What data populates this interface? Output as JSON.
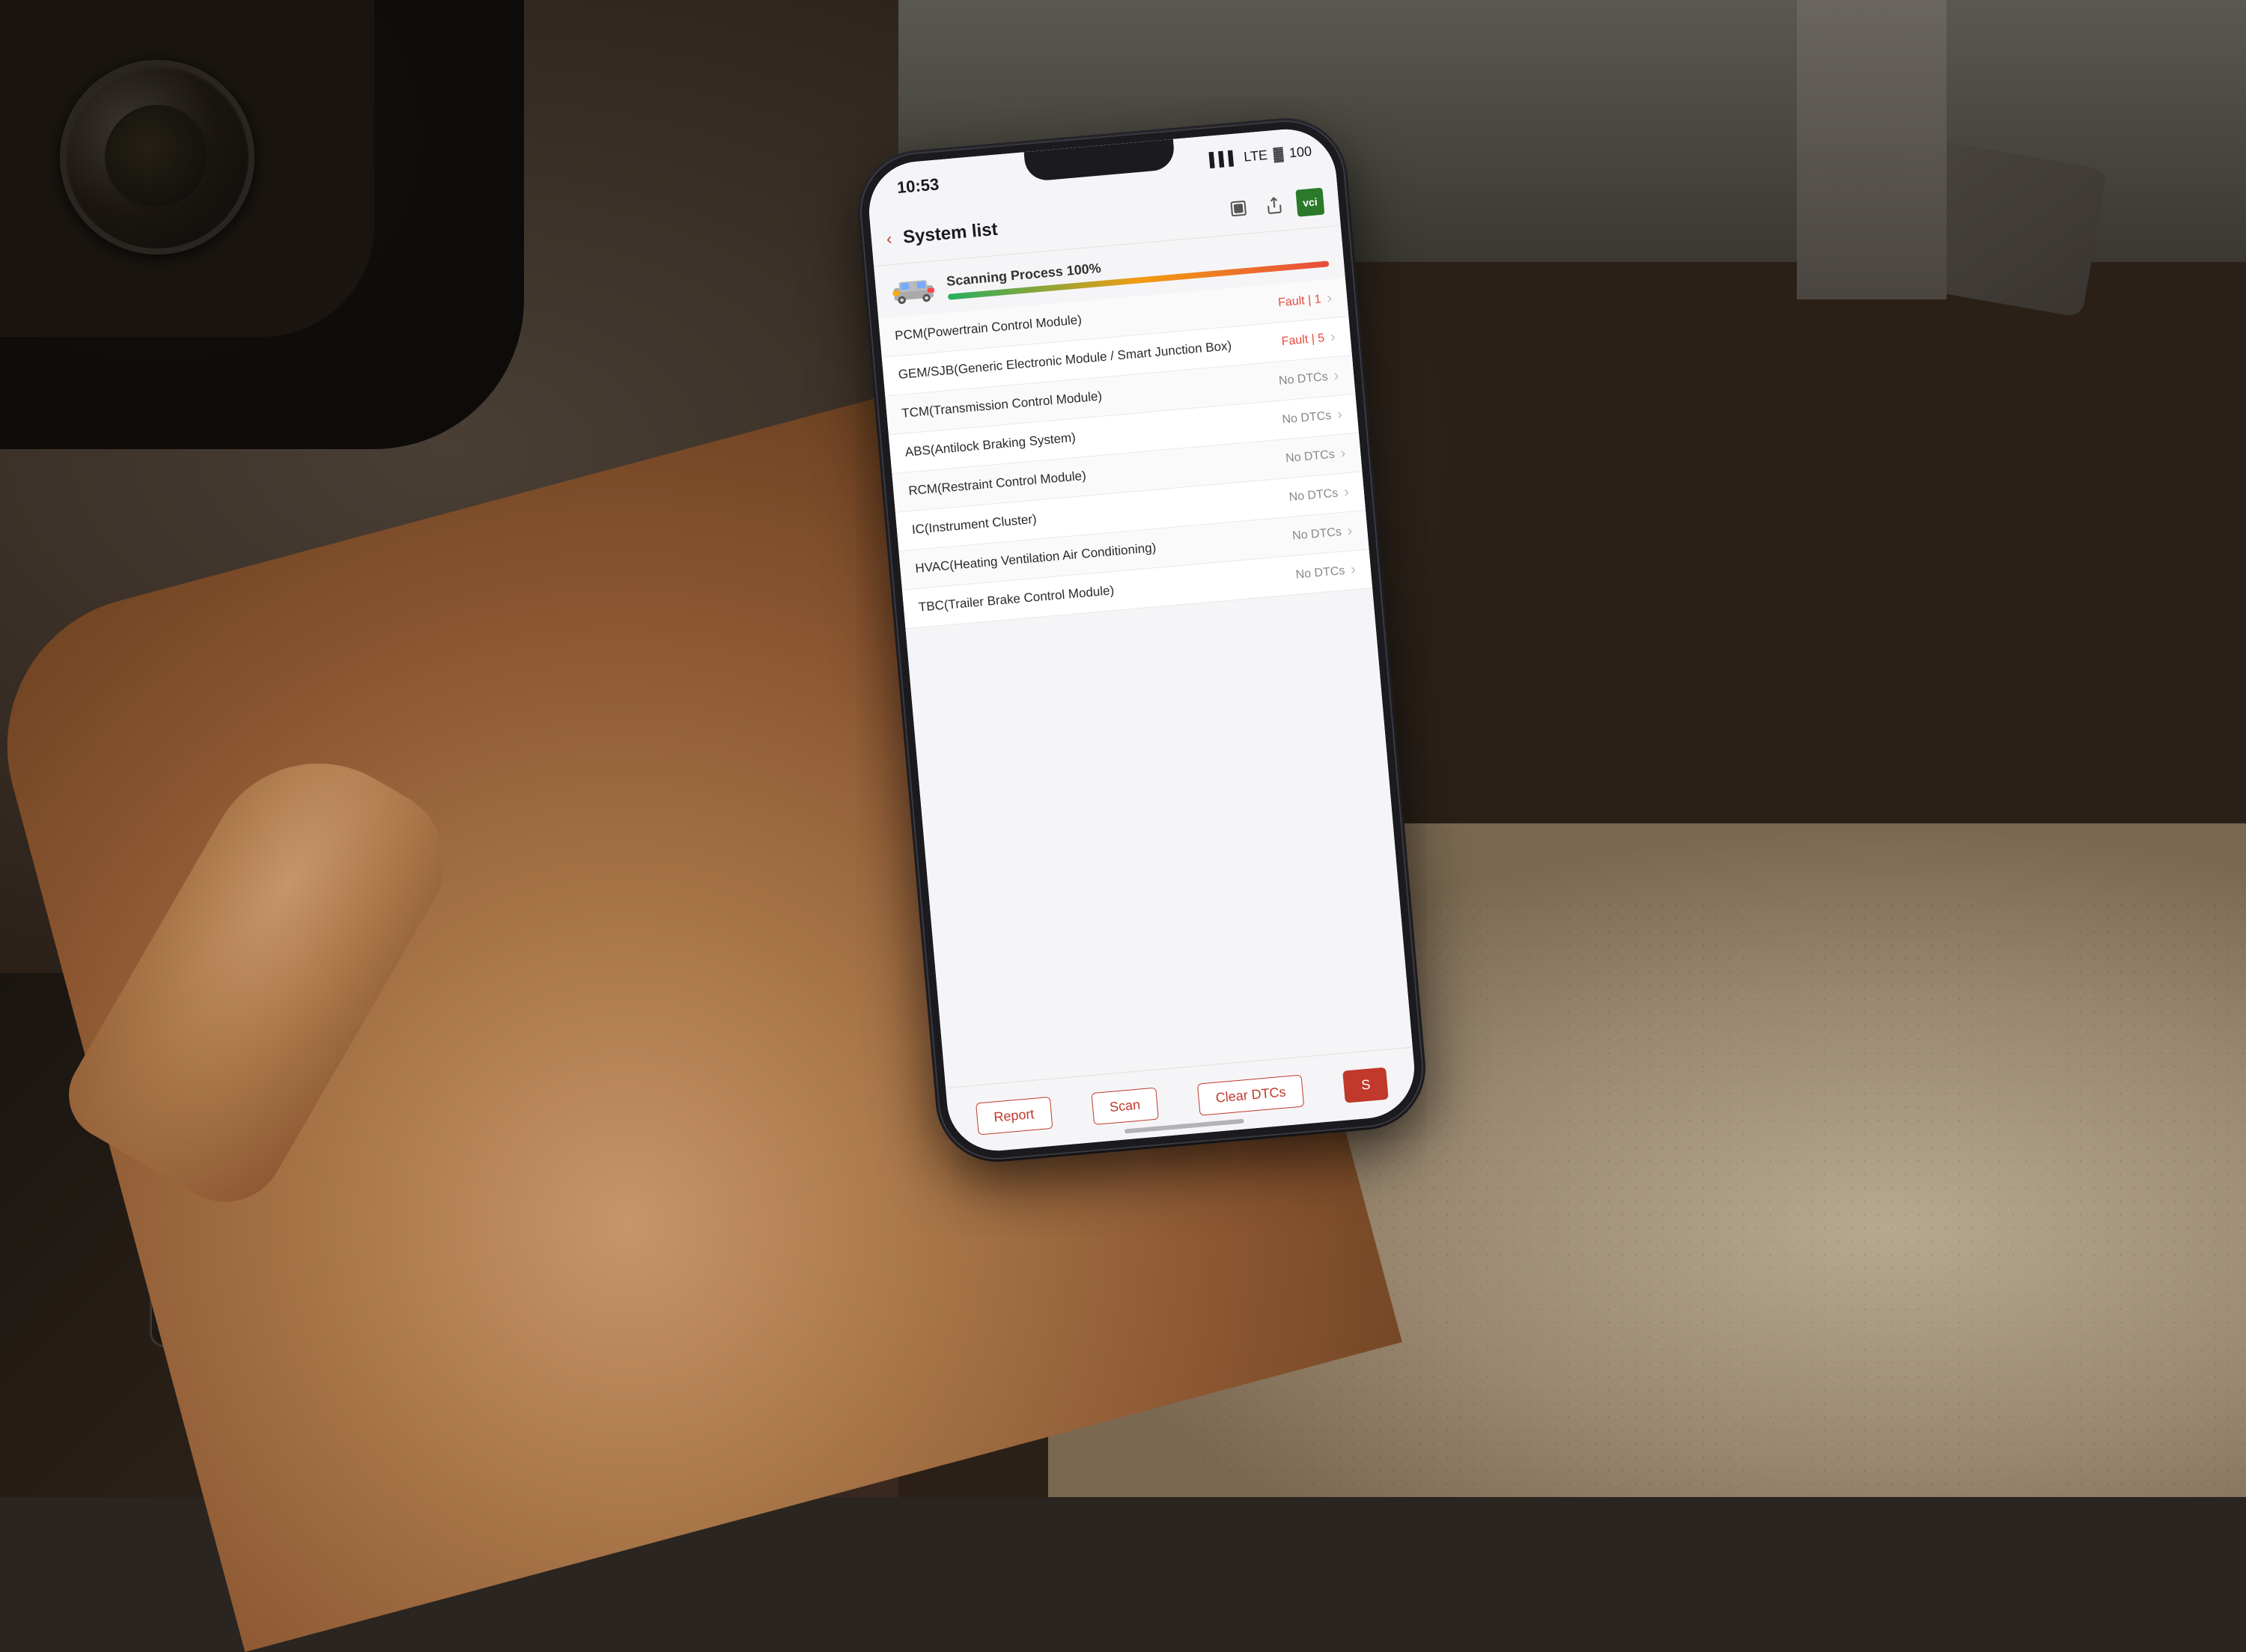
{
  "background": {
    "description": "Car interior with hand holding phone"
  },
  "phone": {
    "status_bar": {
      "time": "10:53",
      "signal": "▌▌▌",
      "network": "LTE",
      "battery": "100"
    },
    "nav": {
      "back_label": "‹",
      "title": "System list",
      "icons": [
        "⬛",
        "↑",
        "vci"
      ]
    },
    "scan_header": {
      "label": "Scanning Process 100%",
      "progress": 100
    },
    "systems": [
      {
        "name": "PCM(Powertrain Control Module)",
        "status_type": "fault",
        "status_label": "Fault | 1"
      },
      {
        "name": "GEM/SJB(Generic Electronic Module / Smart Junction Box)",
        "status_type": "fault",
        "status_label": "Fault | 5"
      },
      {
        "name": "TCM(Transmission Control Module)",
        "status_type": "no_dtc",
        "status_label": "No DTCs"
      },
      {
        "name": "ABS(Antilock Braking System)",
        "status_type": "no_dtc",
        "status_label": "No DTCs"
      },
      {
        "name": "RCM(Restraint Control Module)",
        "status_type": "no_dtc",
        "status_label": "No DTCs"
      },
      {
        "name": "IC(Instrument Cluster)",
        "status_type": "no_dtc",
        "status_label": "No DTCs"
      },
      {
        "name": "HVAC(Heating Ventilation Air Conditioning)",
        "status_type": "no_dtc",
        "status_label": "No DTCs"
      },
      {
        "name": "TBC(Trailer Brake Control Module)",
        "status_type": "no_dtc",
        "status_label": "No DTCs"
      }
    ],
    "bottom_bar": {
      "buttons": [
        "Report",
        "Scan",
        "Clear DTCs",
        "S"
      ]
    }
  }
}
